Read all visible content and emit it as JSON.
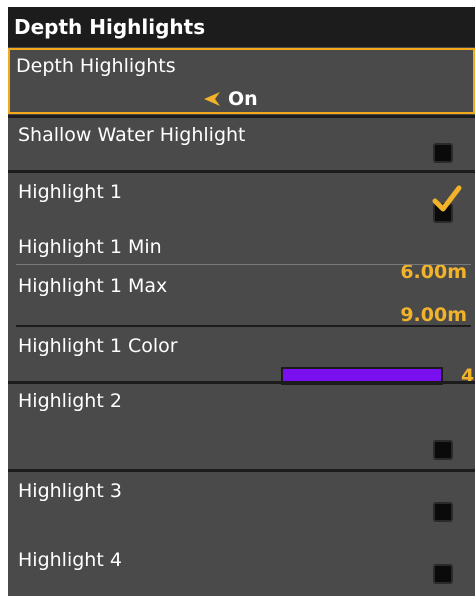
{
  "title": "Depth Highlights",
  "colors": {
    "accent": "#f2b32a",
    "highlight_swatch": "#7a10f0",
    "panel_bg": "#4a4a4a",
    "title_bg": "#1c1c1c"
  },
  "items": {
    "depth_highlights": {
      "label": "Depth Highlights",
      "value": "On",
      "arrow_icon": "left-arrow-icon"
    },
    "shallow_water": {
      "label": "Shallow Water Highlight",
      "checked": false
    },
    "highlight1": {
      "label": "Highlight 1",
      "checked": true
    },
    "highlight1_min": {
      "label": "Highlight 1 Min",
      "value": "6.00m"
    },
    "highlight1_max": {
      "label": "Highlight 1 Max",
      "value": "9.00m"
    },
    "highlight1_color": {
      "label": "Highlight 1 Color",
      "value": "4"
    },
    "highlight2": {
      "label": "Highlight 2",
      "checked": false
    },
    "highlight3": {
      "label": "Highlight 3",
      "checked": false
    },
    "highlight4": {
      "label": "Highlight 4",
      "checked": false
    }
  }
}
